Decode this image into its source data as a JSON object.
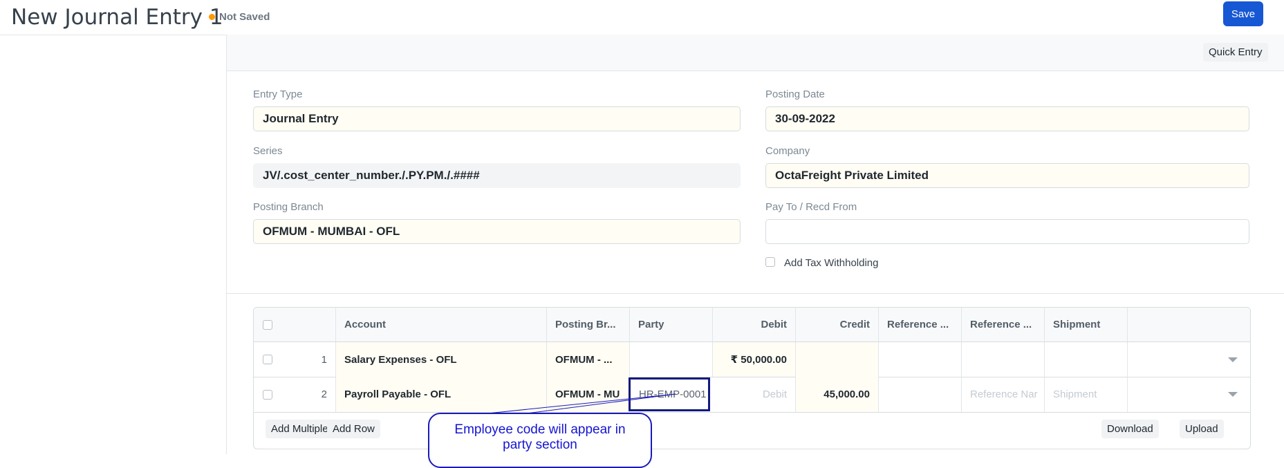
{
  "header": {
    "title": "New Journal Entry 1",
    "status": "Not Saved",
    "save_label": "Save"
  },
  "toolbar": {
    "quick_entry_label": "Quick Entry"
  },
  "form": {
    "entry_type": {
      "label": "Entry Type",
      "value": "Journal Entry"
    },
    "posting_date": {
      "label": "Posting Date",
      "value": "30-09-2022"
    },
    "series": {
      "label": "Series",
      "value": "JV/.cost_center_number./.PY.PM./.####"
    },
    "company": {
      "label": "Company",
      "value": "OctaFreight Private Limited"
    },
    "posting_branch": {
      "label": "Posting Branch",
      "value": "OFMUM - MUMBAI - OFL"
    },
    "pay_to": {
      "label": "Pay To / Recd From",
      "value": ""
    },
    "tax_withholding": {
      "label": "Add Tax Withholding",
      "checked": false
    }
  },
  "table": {
    "columns": [
      "Account",
      "Posting Br...",
      "Party",
      "Debit",
      "Credit",
      "Reference ...",
      "Reference ...",
      "Shipment"
    ],
    "rows": [
      {
        "idx": "1",
        "account": "Salary Expenses - OFL",
        "branch": "OFMUM - ...",
        "party": "",
        "debit": "₹ 50,000.00",
        "credit": "",
        "ref_type": "",
        "ref_name": "",
        "shipment": ""
      },
      {
        "idx": "2",
        "account": "Payroll Payable - OFL",
        "branch": "OFMUM - MU",
        "party": "HR-EMP-0001",
        "debit": "",
        "credit": "45,000.00",
        "ref_type": "",
        "ref_name": "",
        "shipment": ""
      }
    ],
    "placeholders": {
      "debit": "Debit",
      "ref_name": "Reference Nar",
      "shipment": "Shipment"
    },
    "buttons": {
      "add_multiple": "Add Multiple",
      "add_row": "Add Row",
      "download": "Download",
      "upload": "Upload"
    }
  },
  "annotation": {
    "line1": "Employee code will appear in",
    "line2": "party section"
  },
  "colors": {
    "primary": "#1657d4",
    "status_dot": "#ff9900",
    "annotation": "#1414d2",
    "highlight_border": "#121a7e"
  }
}
